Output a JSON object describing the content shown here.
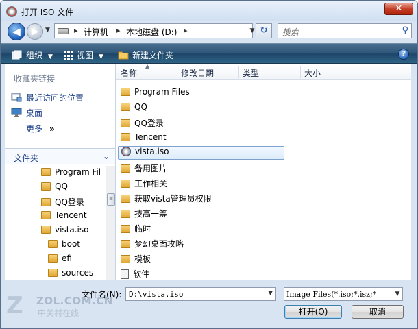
{
  "window": {
    "title": "打开 ISO 文件",
    "close_glyph": "✕"
  },
  "address": {
    "segments": [
      "计算机",
      "本地磁盘 (D:)"
    ],
    "refresh_glyph": "↻",
    "search_placeholder": "搜索"
  },
  "toolbar": {
    "organize": "组织",
    "views": "视图",
    "new_folder": "新建文件夹",
    "help_glyph": "?"
  },
  "favorites": {
    "header": "收藏夹链接",
    "items": [
      "最近访问的位置",
      "桌面"
    ],
    "more": "更多",
    "more_glyph": "»"
  },
  "folders": {
    "label": "文件夹",
    "tree": [
      {
        "label": "Program Fil"
      },
      {
        "label": "QQ"
      },
      {
        "label": "QQ登录"
      },
      {
        "label": "Tencent"
      },
      {
        "label": "vista.iso"
      },
      {
        "label": "boot"
      },
      {
        "label": "efi"
      },
      {
        "label": "sources"
      }
    ]
  },
  "columns": {
    "name": "名称",
    "modified": "修改日期",
    "type": "类型",
    "size": "大小"
  },
  "files": [
    {
      "name": "Program Files",
      "kind": "folder"
    },
    {
      "name": "QQ",
      "kind": "folder"
    },
    {
      "name": "QQ登录",
      "kind": "folder"
    },
    {
      "name": "Tencent",
      "kind": "folder"
    },
    {
      "name": "vista.iso",
      "kind": "iso",
      "selected": true
    },
    {
      "name": "备用图片",
      "kind": "folder"
    },
    {
      "name": "工作相关",
      "kind": "folder"
    },
    {
      "name": "获取vista管理员权限",
      "kind": "folder"
    },
    {
      "name": "技高一筹",
      "kind": "folder"
    },
    {
      "name": "临时",
      "kind": "folder"
    },
    {
      "name": "梦幻桌面攻略",
      "kind": "folder"
    },
    {
      "name": "模板",
      "kind": "folder"
    },
    {
      "name": "软件",
      "kind": "file"
    }
  ],
  "filename": {
    "label": "文件名(N):",
    "value": "D:\\vista.iso"
  },
  "filetype": {
    "value": "Image Files(*.iso;*.isz;*"
  },
  "buttons": {
    "open": "打开(O)",
    "cancel": "取消"
  },
  "watermark": {
    "site": "ZOL.COM.CN",
    "cn": "中关村在线"
  },
  "colors": {
    "toolbar": "#2d5679",
    "link": "#1a3f87",
    "folder": "#e0a733",
    "selection_border": "#7da2ce"
  }
}
